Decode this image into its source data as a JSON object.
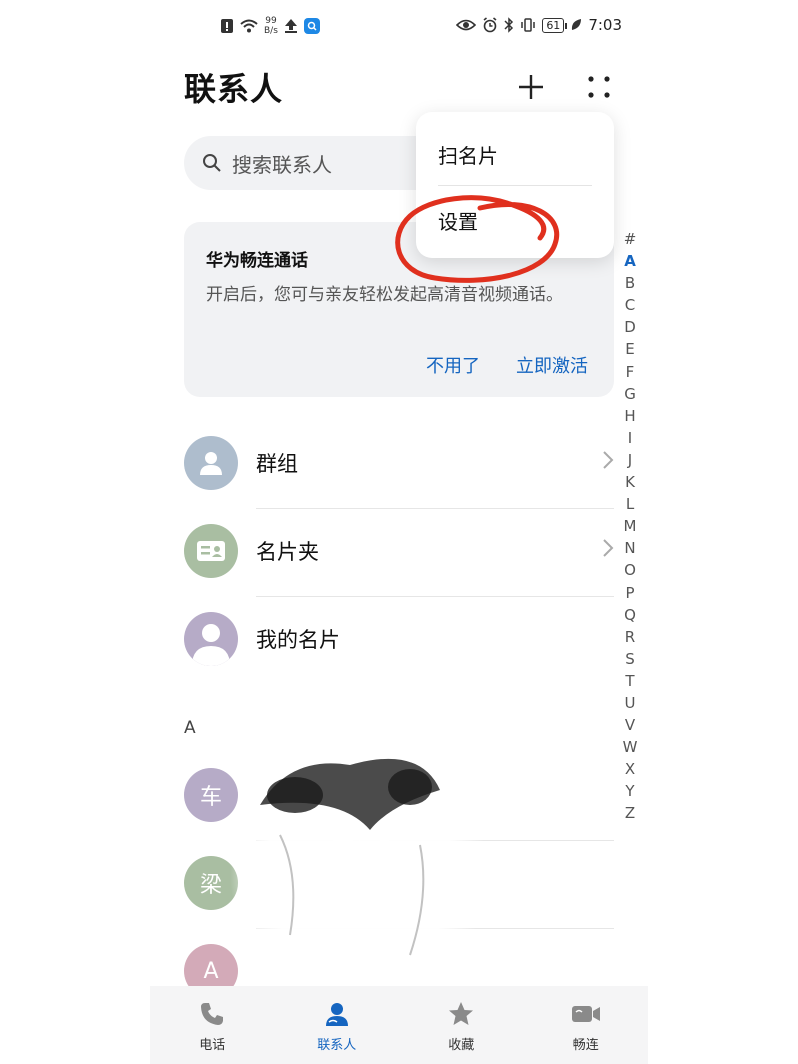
{
  "status_bar": {
    "net_speed_value": "99",
    "net_speed_unit": "B/s",
    "battery": "61",
    "time": "7:03"
  },
  "header": {
    "title": "联系人"
  },
  "search": {
    "placeholder": "搜索联系人"
  },
  "menu": {
    "items": [
      "扫名片",
      "设置"
    ]
  },
  "promo_card": {
    "title": "华为畅连通话",
    "body": "开启后，您可与亲友轻松发起高清音视频通话。",
    "dismiss_label": "不用了",
    "activate_label": "立即激活"
  },
  "rows": {
    "groups": "群组",
    "card_holder": "名片夹",
    "my_card": "我的名片"
  },
  "section_header": "A",
  "contacts": [
    {
      "avatar_letter": "车",
      "color": "#b6abc7"
    },
    {
      "avatar_letter": "梁",
      "color": "#a9bea2"
    },
    {
      "avatar_letter": "A",
      "color": "#d3aab8"
    }
  ],
  "alpha_index": [
    "#",
    "A",
    "B",
    "C",
    "D",
    "E",
    "F",
    "G",
    "H",
    "I",
    "J",
    "K",
    "L",
    "M",
    "N",
    "O",
    "P",
    "Q",
    "R",
    "S",
    "T",
    "U",
    "V",
    "W",
    "X",
    "Y",
    "Z"
  ],
  "alpha_active": "A",
  "bottom_nav": {
    "items": [
      {
        "label": "电话",
        "icon": "phone-icon"
      },
      {
        "label": "联系人",
        "icon": "contacts-icon",
        "active": true
      },
      {
        "label": "收藏",
        "icon": "star-icon"
      },
      {
        "label": "畅连",
        "icon": "video-call-icon"
      }
    ]
  },
  "colors": {
    "accent": "#1565c0",
    "annotation_red": "#e0301e"
  }
}
